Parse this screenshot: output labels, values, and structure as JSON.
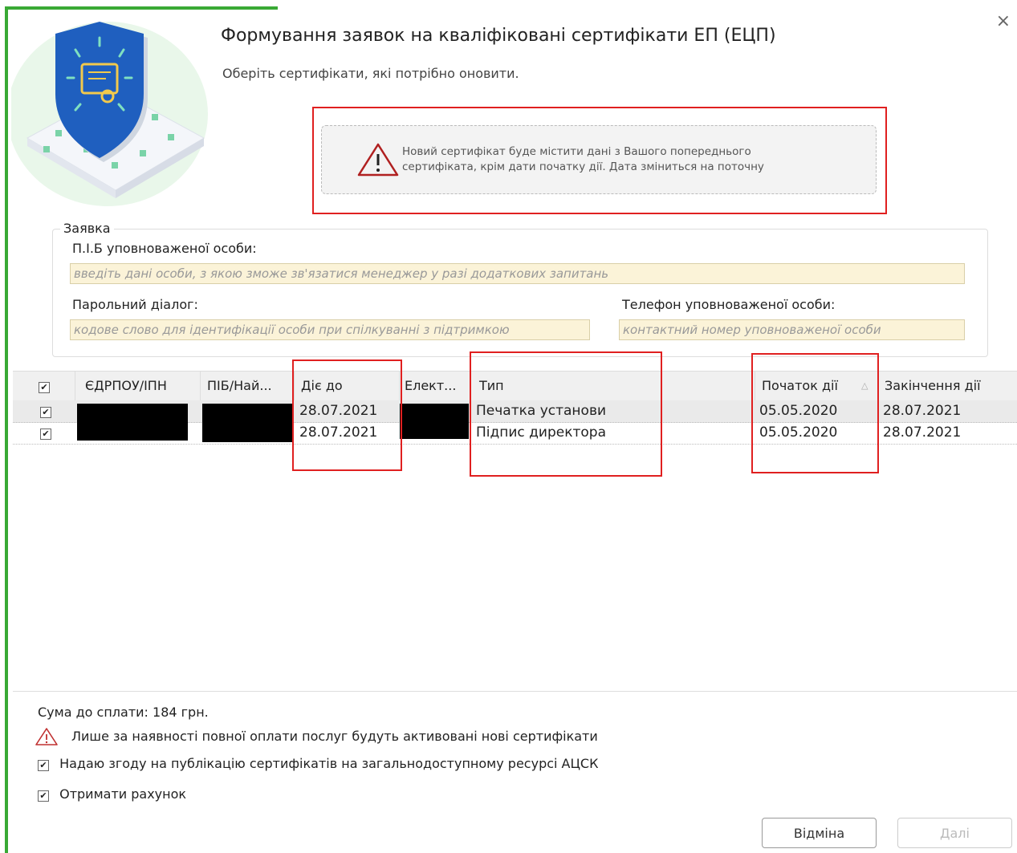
{
  "dialog": {
    "title": "Формування заявок на кваліфіковані сертифікати ЕП (ЕЦП)",
    "subtitle": "Оберіть сертифікати, які потрібно оновити.",
    "close_glyph": "×"
  },
  "notice": {
    "line1": "Новий сертифікат буде містити дані з Вашого попереднього",
    "line2": "сертифіката, крім дати початку дії. Дата зміниться на поточну",
    "icon": "warning-triangle-icon"
  },
  "form": {
    "legend": "Заявка",
    "person_label": "П.І.Б уповноваженої особи:",
    "person_placeholder": "введіть дані особи, з якою зможе зв'язатися менеджер у разі додаткових запитань",
    "password_label": "Парольний діалог:",
    "password_placeholder": "кодове слово для ідентифікації особи при спілкуванні з підтримкою",
    "phone_label": "Телефон уповноваженої особи:",
    "phone_placeholder": "контактний номер уповноваженої особи"
  },
  "table": {
    "columns": [
      "ЄДРПОУ/ІПН",
      "ПІБ/Най...",
      "Діє до",
      "Елект...",
      "Тип",
      "Початок дії",
      "Закінчення дії"
    ],
    "header_check": "✔",
    "rows": [
      {
        "checked": "✔",
        "valid_to": "28.07.2021",
        "type": "Печатка установи",
        "start": "05.05.2020",
        "end": "28.07.2021"
      },
      {
        "checked": "✔",
        "valid_to": "28.07.2021",
        "type": "Підпис директора",
        "start": "05.05.2020",
        "end": "28.07.2021"
      }
    ],
    "sort_glyph": "△"
  },
  "footer": {
    "sum": "Сума до сплати: 184 грн.",
    "warning": "Лише за наявності повної оплати послуг будуть активовані нові сертифікати",
    "consent": "Надаю згоду на публікацію сертифікатів на загальнодоступному ресурсі АЦСК",
    "invoice": "Отримати рахунок",
    "check": "✔"
  },
  "buttons": {
    "cancel": "Відміна",
    "next": "Далі"
  },
  "colors": {
    "accent_green": "#39a935",
    "highlight_red": "#e02020",
    "input_bg": "#fbf3d8"
  }
}
